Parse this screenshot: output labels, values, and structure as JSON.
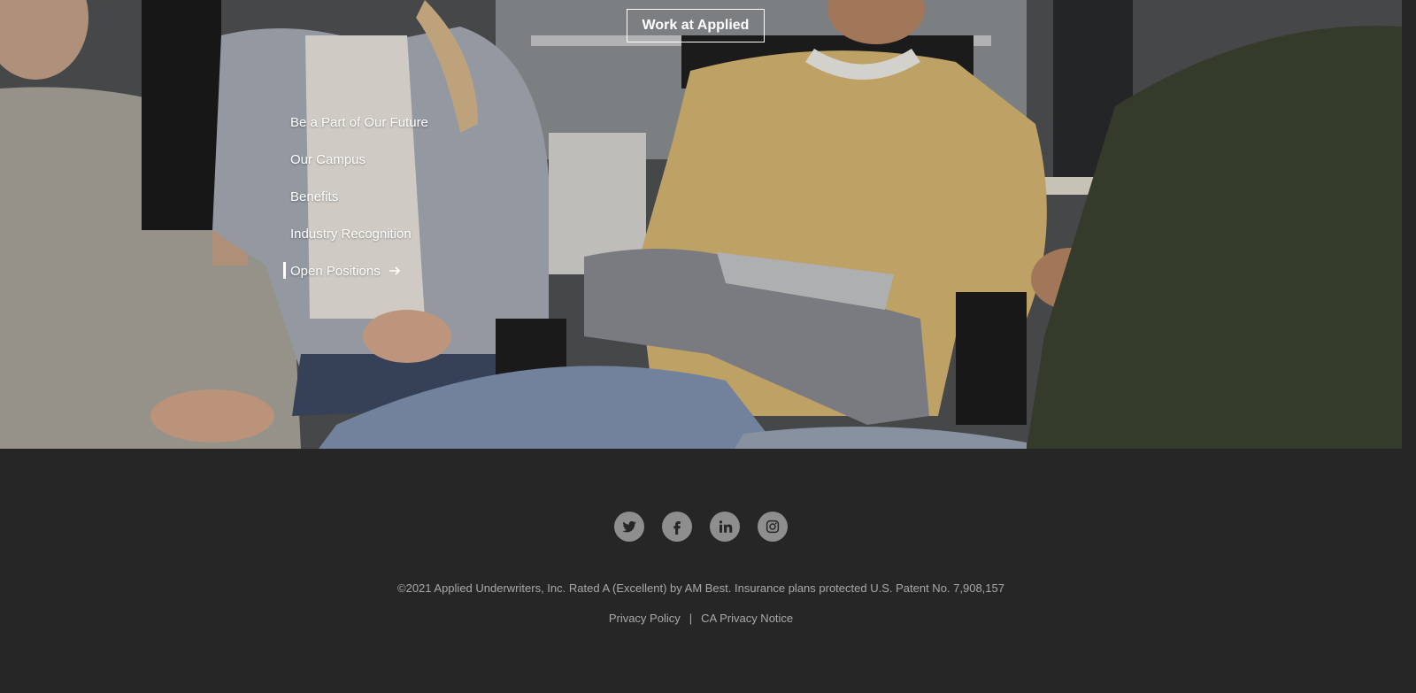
{
  "header": {
    "work_button_label": "Work at Applied"
  },
  "nav": {
    "items": [
      {
        "label": "Be a Part of Our Future"
      },
      {
        "label": "Our Campus"
      },
      {
        "label": "Benefits"
      },
      {
        "label": "Industry Recognition"
      },
      {
        "label": "Open Positions"
      }
    ],
    "active_index": 4
  },
  "footer": {
    "social": [
      {
        "icon": "twitter-icon"
      },
      {
        "icon": "facebook-icon"
      },
      {
        "icon": "linkedin-icon"
      },
      {
        "icon": "instagram-icon"
      }
    ],
    "copyright": "©2021 Applied Underwriters, Inc. Rated A (Excellent) by AM Best. Insurance plans protected U.S. Patent No. 7,908,157",
    "privacy_policy": "Privacy Policy",
    "separator": "|",
    "ca_privacy_notice": "CA Privacy Notice"
  },
  "colors": {
    "footer_bg": "#262626",
    "footer_text": "#a9a9a9",
    "social_circle": "#8e8e8e",
    "nav_text": "#ffffff"
  }
}
